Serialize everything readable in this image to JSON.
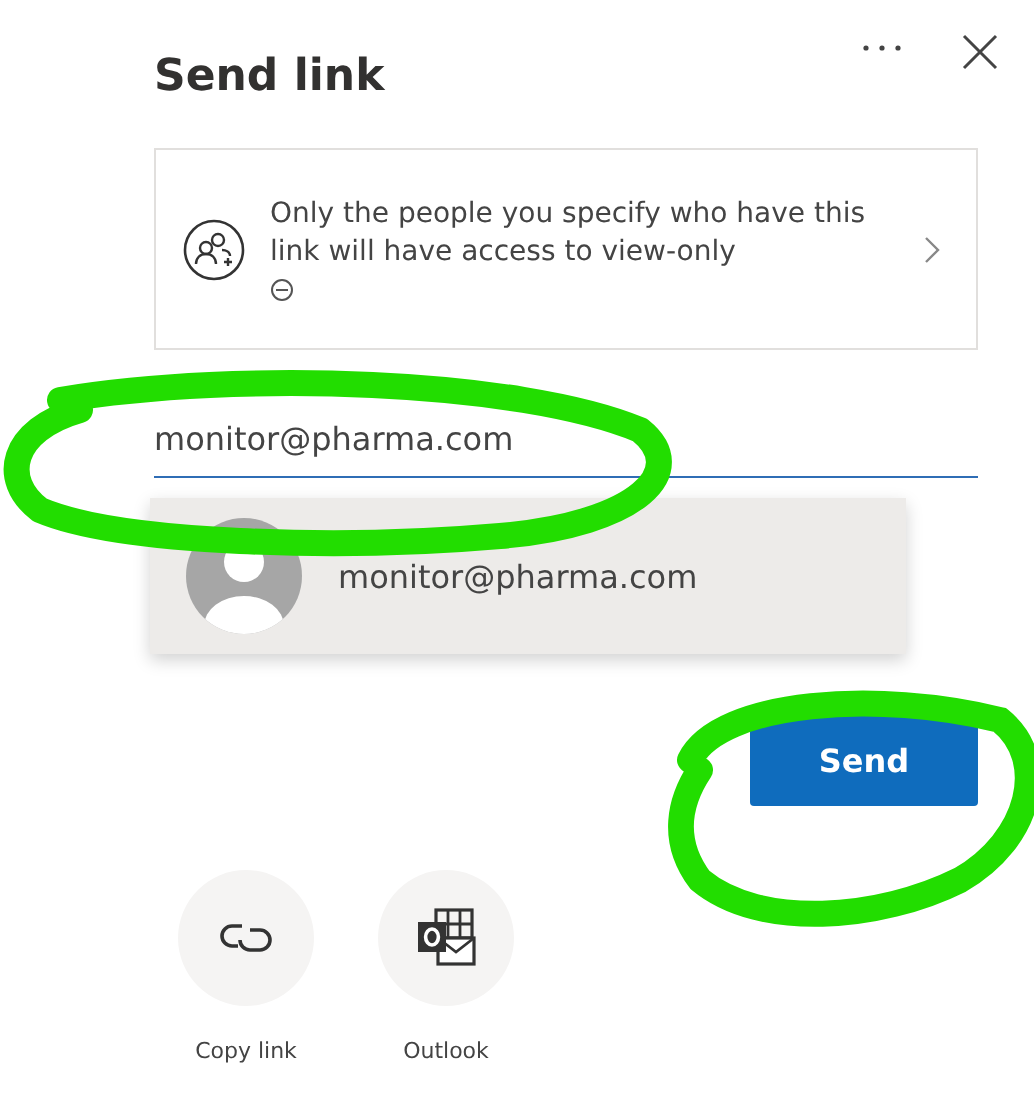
{
  "dialog": {
    "title": "Send link"
  },
  "permission": {
    "text": "Only the people you specify who have this link will have access to view-only"
  },
  "recipient_field": {
    "value": "monitor@pharma.com"
  },
  "suggestions": [
    {
      "email": "monitor@pharma.com",
      "selected": true
    }
  ],
  "send_button": {
    "label": "Send"
  },
  "share_options": [
    {
      "kind": "copy",
      "label": "Copy link"
    },
    {
      "kind": "outlook",
      "label": "Outlook"
    }
  ],
  "annotations": [
    {
      "kind": "ellipse"
    },
    {
      "kind": "ellipse"
    }
  ]
}
